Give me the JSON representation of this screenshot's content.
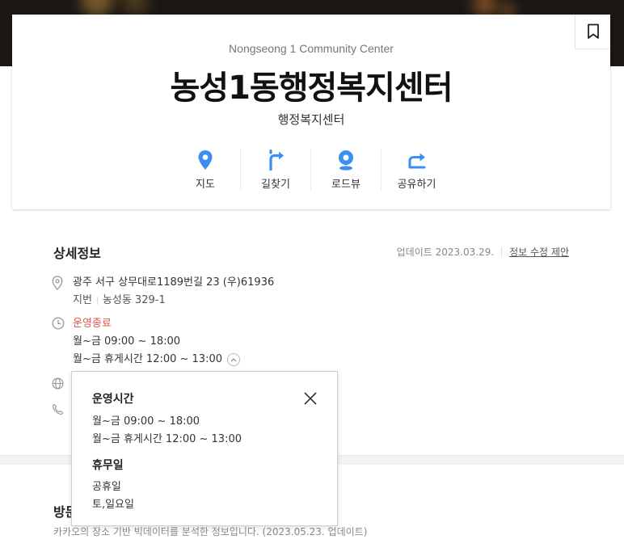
{
  "place": {
    "en_name": "Nongseong 1 Community Center",
    "kr_name": "농성1동행정복지센터",
    "category": "행정복지센터"
  },
  "actions": [
    {
      "label": "지도",
      "icon": "location-pin-icon"
    },
    {
      "label": "길찾기",
      "icon": "directions-icon"
    },
    {
      "label": "로드뷰",
      "icon": "roadview-icon"
    },
    {
      "label": "공유하기",
      "icon": "share-icon"
    }
  ],
  "detail": {
    "title": "상세정보",
    "update": "업데이트 2023.03.29.",
    "suggest": "정보 수정 제안",
    "address": "광주 서구 상무대로1189번길 23 (우)61936",
    "jibun_label": "지번",
    "jibun_value": "농성동 329-1",
    "status": "운영종료",
    "hours": "월~금  09:00 ~ 18:00",
    "break": "월~금 휴게시간  12:00 ~ 13:00"
  },
  "popup": {
    "hours_title": "운영시간",
    "hours": "월~금  09:00 ~ 18:00",
    "break": "월~금 휴게시간  12:00 ~ 13:00",
    "holiday_title": "휴무일",
    "holiday_1": "공휴일",
    "holiday_2": "토,일요일"
  },
  "visit": {
    "title": "방문",
    "note": "카카오의 장소 기반 빅데이터를 분석한 정보입니다. (2023.05.23. 업데이트)"
  },
  "colors": {
    "accent": "#3b8ff0",
    "closed": "#e0544c"
  }
}
